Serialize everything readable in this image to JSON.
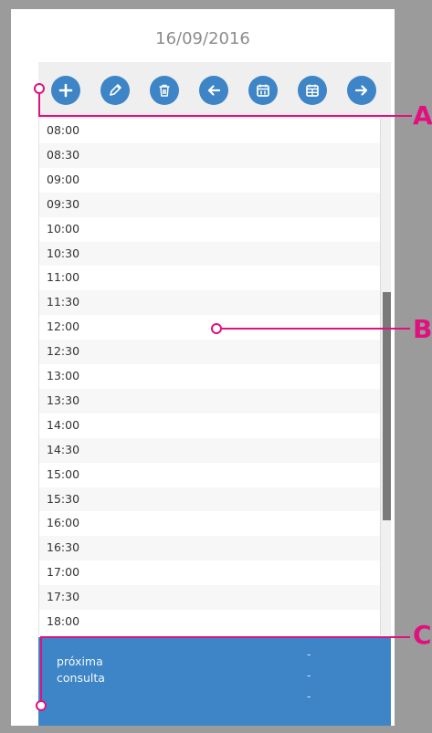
{
  "header": {
    "date": "16/09/2016"
  },
  "toolbar": {
    "buttons": [
      {
        "icon": "plus-icon"
      },
      {
        "icon": "pencil-icon"
      },
      {
        "icon": "trash-icon"
      },
      {
        "icon": "arrow-left-icon"
      },
      {
        "icon": "calendar-day-icon"
      },
      {
        "icon": "calendar-week-icon"
      },
      {
        "icon": "arrow-right-icon"
      }
    ]
  },
  "schedule": {
    "times": [
      "08:00",
      "08:30",
      "09:00",
      "09:30",
      "10:00",
      "10:30",
      "11:00",
      "11:30",
      "12:00",
      "12:30",
      "13:00",
      "13:30",
      "14:00",
      "14:30",
      "15:00",
      "15:30",
      "16:00",
      "16:30",
      "17:00",
      "17:30",
      "18:00"
    ]
  },
  "footer": {
    "label_line1": "próxima",
    "label_line2": "consulta",
    "values": [
      "-",
      "-",
      "-"
    ]
  },
  "annotations": {
    "a": "A",
    "b": "B",
    "c": "C"
  },
  "colors": {
    "accent": "#3d85c6",
    "annotation": "#e0117f",
    "background": "#9b9b9b"
  }
}
